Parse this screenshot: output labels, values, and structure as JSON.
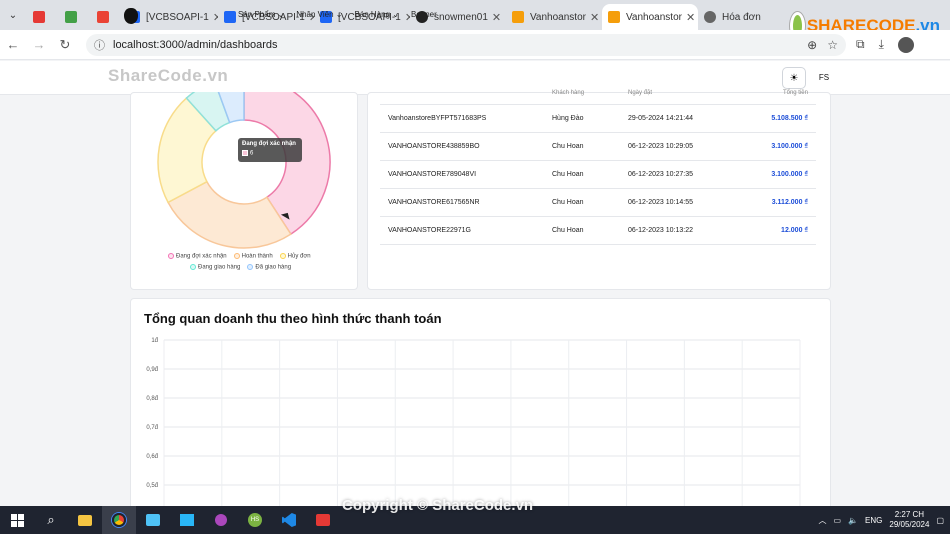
{
  "browser": {
    "tabs": [
      {
        "label": "",
        "active": false
      },
      {
        "label": "",
        "active": false
      },
      {
        "label": "",
        "active": false
      },
      {
        "label": "[VCBSOAPI-1",
        "active": false
      },
      {
        "label": "[VCBSOAPI-1",
        "active": false
      },
      {
        "label": "[VCBSOAPI-1",
        "active": false
      },
      {
        "label": "snowmen01",
        "active": false
      },
      {
        "label": "Vanhoanstor",
        "active": false
      },
      {
        "label": "Vanhoanstor",
        "active": true
      },
      {
        "label": "Hóa đơn",
        "active": false
      }
    ],
    "url": "localhost:3000/admin/dashboards"
  },
  "app": {
    "nav": [
      "Sản Phẩm",
      "Nhân Viên",
      "Bán Hàng",
      "Banner"
    ],
    "user_initials": "FS"
  },
  "donut": {
    "tooltip_title": "Đang đợi xác nhận",
    "tooltip_value": "6",
    "legend": [
      {
        "label": "Đang đợi xác nhận",
        "color": "#f9a8c5"
      },
      {
        "label": "Hoàn thành",
        "color": "#fcd9b6"
      },
      {
        "label": "Hủy đơn",
        "color": "#fde68a"
      },
      {
        "label": "Đang giao hàng",
        "color": "#99e6e0"
      },
      {
        "label": "Đã giao hàng",
        "color": "#a5cff5"
      }
    ]
  },
  "orders": {
    "headers": [
      "",
      "Khách hàng",
      "Ngày đặt",
      "Tổng tiền"
    ],
    "rows": [
      {
        "code": "VanhoanstoreBYFPT571683PS",
        "customer": "Hùng Đào",
        "date": "29-05-2024 14:21:44",
        "amount": "5.108.500 ₫"
      },
      {
        "code": "VANHOANSTORE438859BO",
        "customer": "Chu Hoan",
        "date": "06-12-2023 10:29:05",
        "amount": "3.100.000 ₫"
      },
      {
        "code": "VANHOANSTORE789048VI",
        "customer": "Chu Hoan",
        "date": "06-12-2023 10:27:35",
        "amount": "3.100.000 ₫"
      },
      {
        "code": "VANHOANSTORE617565NR",
        "customer": "Chu Hoan",
        "date": "06-12-2023 10:14:55",
        "amount": "3.112.000 ₫"
      },
      {
        "code": "VANHOANSTORE22971G",
        "customer": "Chu Hoan",
        "date": "06-12-2023 10:13:22",
        "amount": "12.000 ₫"
      }
    ]
  },
  "chart_data": {
    "type": "bar",
    "title": "Tổng quan doanh thu theo hình thức thanh toán",
    "y_ticks": [
      "1đ",
      "0,9đ",
      "0,8đ",
      "0,7đ",
      "0,6đ",
      "0,5đ"
    ],
    "ylim": [
      0.5,
      1
    ],
    "grid": true,
    "series": []
  },
  "taskbar": {
    "lang": "ENG",
    "time": "2:27 CH",
    "date": "29/05/2024"
  },
  "watermark": "Copyright © ShareCode.vn",
  "watermark_top": "ShareCode.vn",
  "brand": {
    "text": "SHARECODE",
    "suffix": ".vn"
  }
}
